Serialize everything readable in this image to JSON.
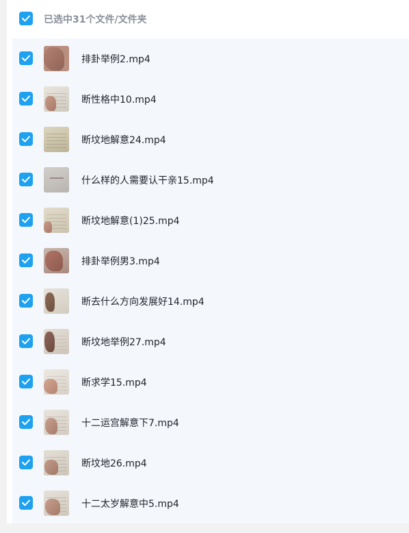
{
  "header": {
    "selection_text": "已选中31个文件/文件夹",
    "checkbox_checked": true
  },
  "colors": {
    "accent": "#1ea1ef",
    "list_background": "#f4f8fd",
    "header_text": "#8a8f99",
    "file_text": "#1f2329"
  },
  "files": [
    {
      "name": "排卦举例2.mp4",
      "checked": true
    },
    {
      "name": "断性格中10.mp4",
      "checked": true
    },
    {
      "name": "断坟地解意24.mp4",
      "checked": true
    },
    {
      "name": "什么样的人需要认干亲15.mp4",
      "checked": true
    },
    {
      "name": "断坟地解意(1)25.mp4",
      "checked": true
    },
    {
      "name": "排卦举例男3.mp4",
      "checked": true
    },
    {
      "name": "断去什么方向发展好14.mp4",
      "checked": true
    },
    {
      "name": "断坟地举例27.mp4",
      "checked": true
    },
    {
      "name": "断求学15.mp4",
      "checked": true
    },
    {
      "name": "十二运宫解意下7.mp4",
      "checked": true
    },
    {
      "name": "断坟地26.mp4",
      "checked": true
    },
    {
      "name": "十二太岁解意中5.mp4",
      "checked": true
    }
  ]
}
